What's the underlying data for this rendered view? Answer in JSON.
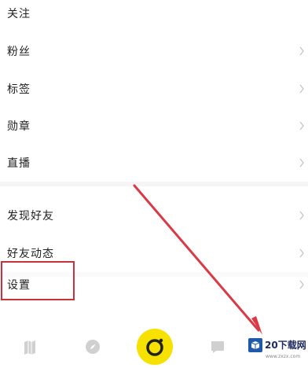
{
  "menu": {
    "group1": [
      {
        "label": "关注"
      },
      {
        "label": "粉丝"
      },
      {
        "label": "标签"
      },
      {
        "label": "勋章"
      },
      {
        "label": "直播"
      }
    ],
    "group2": [
      {
        "label": "发现好友"
      },
      {
        "label": "好友动态"
      }
    ],
    "group3": [
      {
        "label": "设置"
      }
    ]
  },
  "annotation": {
    "box_color": "#c8323c",
    "arrow_color": "#d93a46"
  },
  "bottom_nav": {
    "tabs": [
      {
        "icon": "map-icon"
      },
      {
        "icon": "compass-icon"
      },
      {
        "icon": "camera-icon"
      },
      {
        "icon": "message-icon"
      }
    ],
    "camera_accent": "#f6e100"
  },
  "watermark": {
    "brand": "20下载网",
    "site": "www.zxzx.com"
  }
}
